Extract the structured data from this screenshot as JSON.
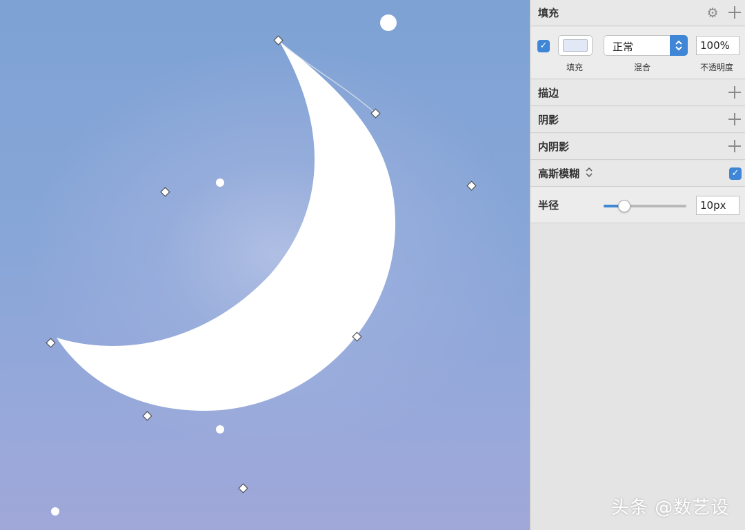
{
  "canvas": {
    "bg_color": "#88a6d8",
    "shape_color": "#ffffff"
  },
  "watermark": "头条 @数艺设",
  "panel": {
    "fill": {
      "title": "填充",
      "enabled": true,
      "color": "#e2e8f6",
      "blend_mode": "正常",
      "opacity": "100%",
      "captions": {
        "fill": "填充",
        "blend": "混合",
        "opacity": "不透明度"
      }
    },
    "border": {
      "title": "描边"
    },
    "shadow": {
      "title": "阴影"
    },
    "inner_shadow": {
      "title": "内阴影"
    },
    "gaussian_blur": {
      "title": "高斯模糊",
      "enabled": true,
      "radius_label": "半径",
      "radius_value": "10px",
      "radius_level": 0.25
    }
  },
  "colors": {
    "accent": "#3f87d6",
    "panel_bg": "#e4e4e4"
  },
  "icons": [
    "checkbox-checked-icon",
    "gear-icon",
    "plus-icon",
    "chevron-updown-icon"
  ]
}
